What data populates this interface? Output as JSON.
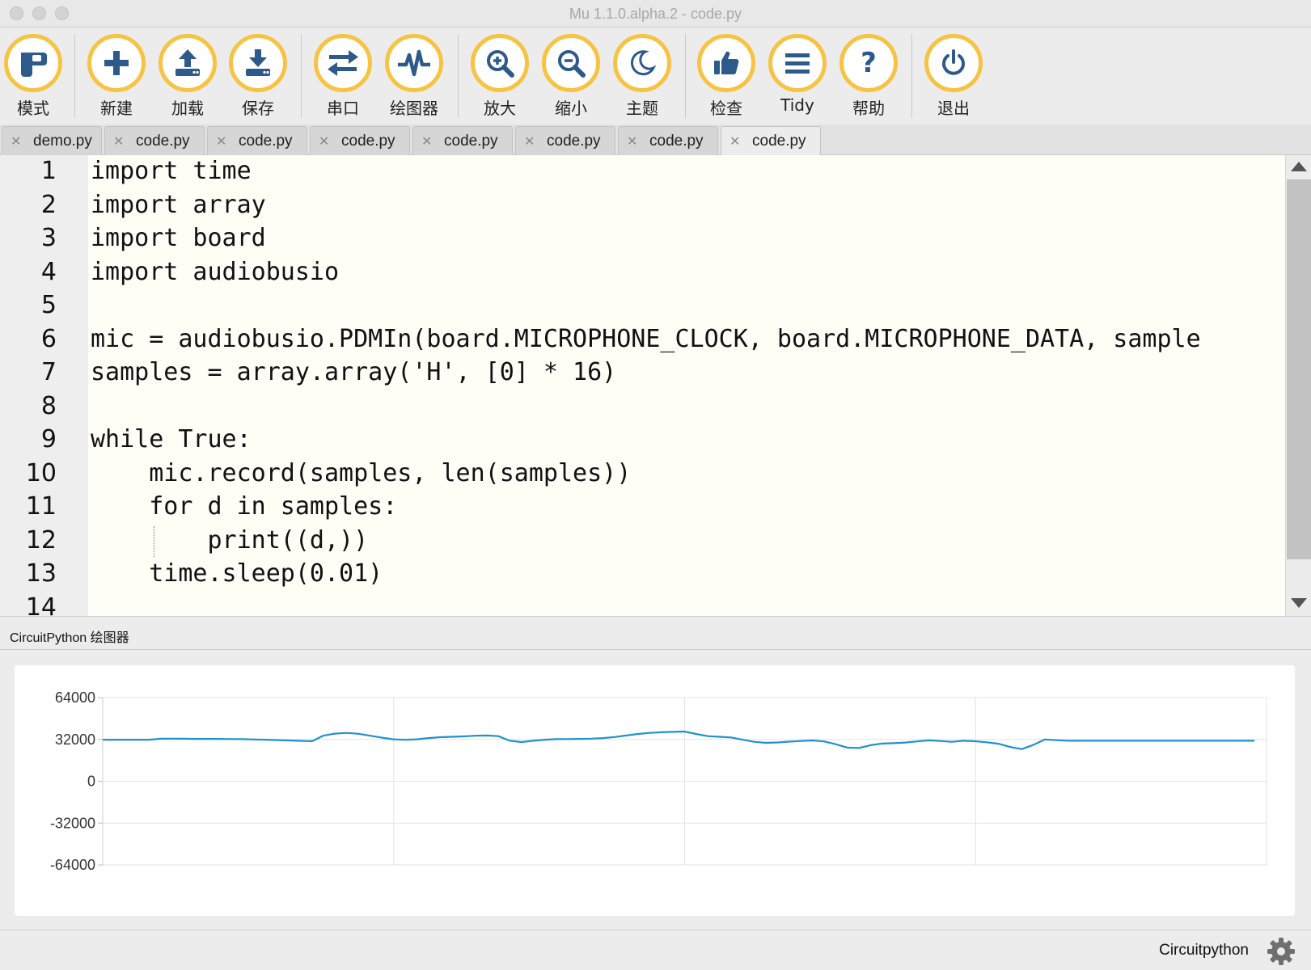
{
  "window": {
    "title": "Mu 1.1.0.alpha.2 - code.py"
  },
  "toolbar": {
    "buttons": [
      {
        "label": "模式",
        "icon": "mode-icon"
      },
      {
        "label": "新建",
        "icon": "plus-icon"
      },
      {
        "label": "加载",
        "icon": "upload-icon"
      },
      {
        "label": "保存",
        "icon": "download-icon"
      },
      {
        "label": "串口",
        "icon": "swap-arrows-icon"
      },
      {
        "label": "绘图器",
        "icon": "pulse-icon"
      },
      {
        "label": "放大",
        "icon": "zoom-in-icon"
      },
      {
        "label": "缩小",
        "icon": "zoom-out-icon"
      },
      {
        "label": "主题",
        "icon": "moon-icon"
      },
      {
        "label": "检查",
        "icon": "thumbs-up-icon"
      },
      {
        "label": "Tidy",
        "icon": "lines-icon"
      },
      {
        "label": "帮助",
        "icon": "question-icon"
      },
      {
        "label": "退出",
        "icon": "power-icon"
      }
    ]
  },
  "tabs": [
    {
      "name": "demo.py",
      "close": "✕"
    },
    {
      "name": "code.py",
      "close": "✕"
    },
    {
      "name": "code.py",
      "close": "✕"
    },
    {
      "name": "code.py",
      "close": "✕"
    },
    {
      "name": "code.py",
      "close": "✕"
    },
    {
      "name": "code.py",
      "close": "✕"
    },
    {
      "name": "code.py",
      "close": "✕"
    },
    {
      "name": "code.py",
      "close": "✕",
      "active": true
    }
  ],
  "editor": {
    "line_numbers": [
      "1",
      "2",
      "3",
      "4",
      "5",
      "6",
      "7",
      "8",
      "9",
      "10",
      "11",
      "12",
      "13",
      "14"
    ],
    "lines": [
      "import time",
      "import array",
      "import board",
      "import audiobusio",
      "",
      "mic = audiobusio.PDMIn(board.MICROPHONE_CLOCK, board.MICROPHONE_DATA, sample",
      "samples = array.array('H', [0] * 16)",
      "",
      "while True:",
      "    mic.record(samples, len(samples))",
      "    for d in samples:",
      "        print((d,))",
      "    time.sleep(0.01)",
      ""
    ]
  },
  "plotter": {
    "title": "CircuitPython 绘图器"
  },
  "chart_data": {
    "type": "line",
    "ylim": [
      -64000,
      64000
    ],
    "yticks": [
      "64000",
      "32000",
      "0",
      "-32000",
      "-64000"
    ],
    "grid": true,
    "series_color": "#1f91d0",
    "values": [
      31800,
      31800,
      31800,
      31800,
      31800,
      32500,
      32600,
      32500,
      32400,
      32400,
      32400,
      32300,
      32200,
      32000,
      31800,
      31500,
      31200,
      30900,
      30700,
      35000,
      36500,
      37000,
      36300,
      34800,
      33300,
      32100,
      31700,
      32100,
      33000,
      33700,
      34000,
      34300,
      34800,
      35000,
      34500,
      31000,
      30000,
      31000,
      31800,
      32200,
      32300,
      32400,
      32600,
      33000,
      33800,
      35000,
      36200,
      37000,
      37500,
      37800,
      38000,
      36200,
      34500,
      34000,
      33500,
      31800,
      30200,
      29400,
      29700,
      30300,
      30800,
      31200,
      30500,
      28300,
      25800,
      25400,
      27600,
      28800,
      29100,
      29600,
      30500,
      31300,
      30800,
      30200,
      31000,
      30600,
      29800,
      28700,
      26200,
      24600,
      27800,
      32000,
      31400,
      31000,
      31000,
      31000,
      31000,
      31000,
      31000,
      31000,
      31000,
      31000,
      31000,
      31000,
      31000,
      31000,
      31000,
      31000,
      31000,
      31000
    ]
  },
  "statusbar": {
    "mode": "Circuitpython",
    "settings_icon": "gear-icon"
  }
}
